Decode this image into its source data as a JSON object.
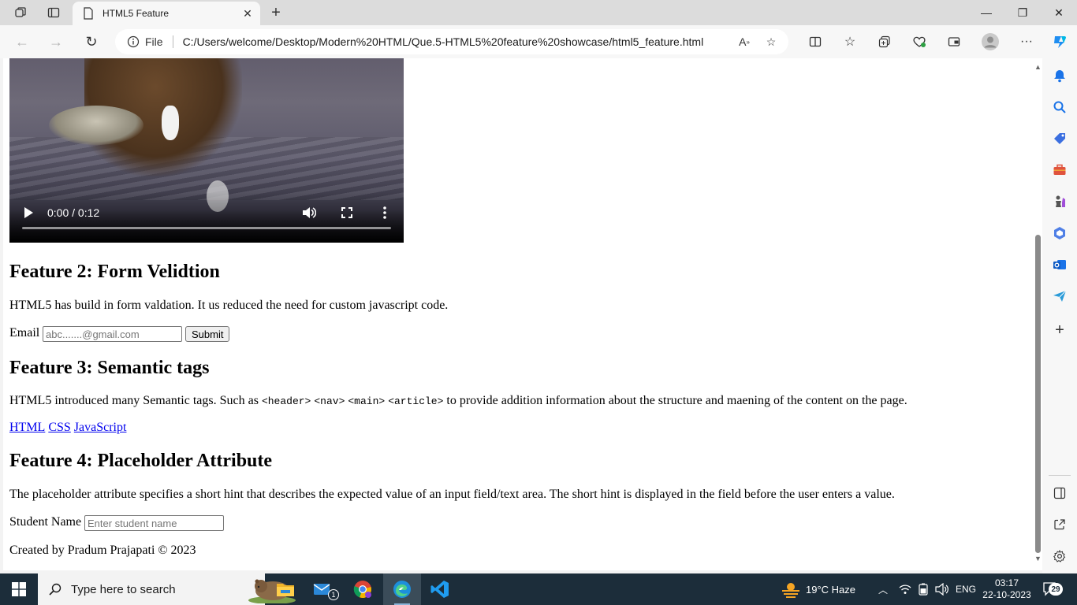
{
  "browser": {
    "tab_title": "HTML5 Feature",
    "address_scheme_label": "File",
    "url": "C:/Users/welcome/Desktop/Modern%20HTML/Que.5-HTML5%20feature%20showcase/html5_feature.html"
  },
  "video": {
    "time": "0:00 / 0:12",
    "progress": 0
  },
  "feature2": {
    "heading": "Feature 2: Form Velidtion",
    "text": "HTML5 has build in form valdation. It us reduced the need for custom javascript code.",
    "email_label": "Email",
    "email_placeholder": "abc.......@gmail.com",
    "submit_label": "Submit"
  },
  "feature3": {
    "heading": "Feature 3: Semantic tags",
    "text_before": "HTML5 introduced many Semantic tags. Such as",
    "tags": [
      "<header>",
      "<nav>",
      "<main>",
      "<article>"
    ],
    "text_after": "to provide addition information about the structure and maening of the content on the page.",
    "links": [
      "HTML",
      "CSS",
      "JavaScript"
    ]
  },
  "feature4": {
    "heading": "Feature 4: Placeholder Attribute",
    "text": "The placeholder attribute specifies a short hint that describes the expected value of an input field/text area. The short hint is displayed in the field before the user enters a value.",
    "student_label": "Student Name",
    "student_placeholder": "Enter student name"
  },
  "footer": {
    "text": "Created by Pradum Prajapati © 2023"
  },
  "taskbar": {
    "search_placeholder": "Type here to search",
    "mail_badge": "1",
    "weather": "19°C  Haze",
    "language": "ENG",
    "time": "03:17",
    "date": "22-10-2023",
    "notification_count": "29"
  }
}
